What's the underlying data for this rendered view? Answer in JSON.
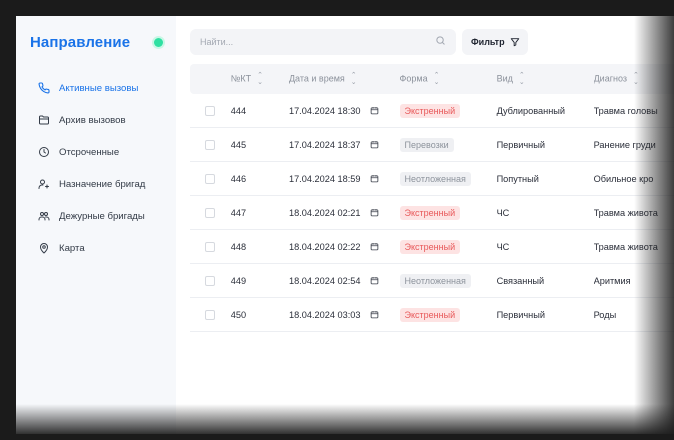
{
  "sidebar": {
    "brand": "Направление",
    "items": [
      {
        "label": "Активные вызовы",
        "icon": "phone-icon",
        "active": true
      },
      {
        "label": "Архив вызовов",
        "icon": "folder-icon",
        "active": false
      },
      {
        "label": "Отсроченные",
        "icon": "clock-icon",
        "active": false
      },
      {
        "label": "Назначение бригад",
        "icon": "user-plus-icon",
        "active": false
      },
      {
        "label": "Дежурные бригады",
        "icon": "users-icon",
        "active": false
      },
      {
        "label": "Карта",
        "icon": "map-pin-icon",
        "active": false
      }
    ]
  },
  "toolbar": {
    "search_placeholder": "Найти...",
    "filter_label": "Фильтр"
  },
  "table": {
    "columns": [
      "№КТ",
      "Дата и время",
      "Форма",
      "Вид",
      "Диагноз"
    ],
    "rows": [
      {
        "num": "444",
        "datetime": "17.04.2024 18:30",
        "form": "Экстренный",
        "form_style": "red",
        "type": "Дублированный",
        "diagnosis": "Травма головы"
      },
      {
        "num": "445",
        "datetime": "17.04.2024 18:37",
        "form": "Перевозки",
        "form_style": "grey",
        "type": "Первичный",
        "diagnosis": "Ранение груди"
      },
      {
        "num": "446",
        "datetime": "17.04.2024 18:59",
        "form": "Неотложенная",
        "form_style": "grey",
        "type": "Попутный",
        "diagnosis": "Обильное кро"
      },
      {
        "num": "447",
        "datetime": "18.04.2024 02:21",
        "form": "Экстренный",
        "form_style": "red",
        "type": "ЧС",
        "diagnosis": "Травма живота"
      },
      {
        "num": "448",
        "datetime": "18.04.2024 02:22",
        "form": "Экстренный",
        "form_style": "red",
        "type": "ЧС",
        "diagnosis": "Травма живота"
      },
      {
        "num": "449",
        "datetime": "18.04.2024 02:54",
        "form": "Неотложенная",
        "form_style": "grey",
        "type": "Связанный",
        "diagnosis": "Аритмия"
      },
      {
        "num": "450",
        "datetime": "18.04.2024 03:03",
        "form": "Экстренный",
        "form_style": "red",
        "type": "Первичный",
        "diagnosis": "Роды"
      }
    ]
  },
  "colors": {
    "accent": "#1a73e8",
    "status_online": "#2fe0a2",
    "badge_red_bg": "#fde3e3",
    "badge_red_text": "#e8595a",
    "badge_grey_bg": "#eff0f3",
    "badge_grey_text": "#8d939c"
  }
}
